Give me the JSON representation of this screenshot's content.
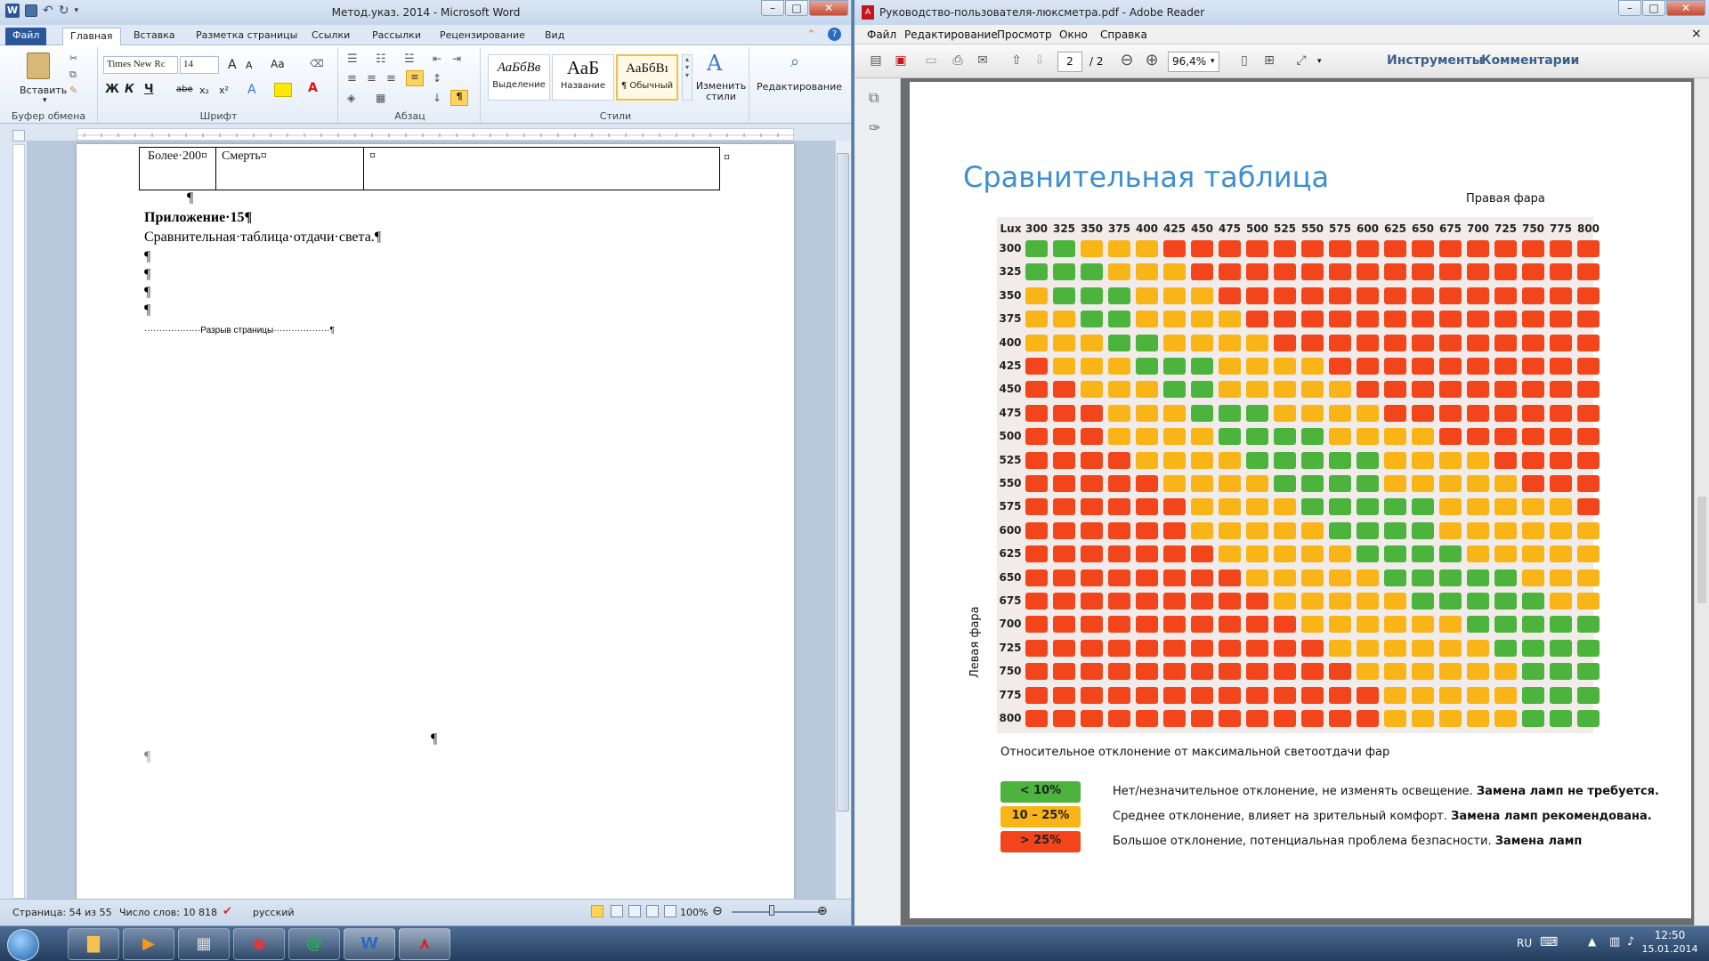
{
  "word": {
    "title": "Метод.указ. 2014  -  Microsoft Word",
    "tabs": [
      "Файл",
      "Главная",
      "Вставка",
      "Разметка страницы",
      "Ссылки",
      "Рассылки",
      "Рецензирование",
      "Вид"
    ],
    "clipboard": {
      "paste": "Вставить",
      "group": "Буфер обмена"
    },
    "font": {
      "name": "Times New Rc",
      "size": "14",
      "group": "Шрифт",
      "bold": "Ж",
      "italic": "К",
      "underline": "Ч",
      "strike": "abe",
      "sub": "x₂",
      "sup": "x²",
      "grow": "A",
      "shrink": "A",
      "case": "Aa",
      "color": "A"
    },
    "paragraph": {
      "group": "Абзац",
      "pilcrow": "¶"
    },
    "styles": {
      "group": "Стили",
      "items": [
        {
          "sample": "АаБбВв",
          "name": "Выделение"
        },
        {
          "sample": "АаБ",
          "name": "Название"
        },
        {
          "sample": "АаБбВı",
          "name": "¶ Обычный"
        }
      ],
      "change": "Изменить стили"
    },
    "editing": "Редактирование",
    "table": {
      "c1": "Более·200¤",
      "c2": "Смерть¤",
      "c3": "¤",
      "end": "¤"
    },
    "doc": {
      "pil": "¶",
      "heading": "Приложение·15¶",
      "line": "Сравнительная·таблица·отдачи·света.¶",
      "pagebreak": "···················Разрыв страницы···················¶"
    },
    "status": {
      "page": "Страница: 54 из 55",
      "words": "Число слов: 10 818",
      "lang": "русский",
      "zoom": "100%"
    }
  },
  "reader": {
    "title": "Руководство-пользователя-люксметра.pdf - Adobe Reader",
    "menu": [
      "Файл",
      "Редактирование",
      "Просмотр",
      "Окно",
      "Справка"
    ],
    "page_current": "2",
    "page_total": "/ 2",
    "zoom": "96,4%",
    "tools": "Инструменты",
    "comments": "Комментарии"
  },
  "pdf": {
    "title": "Сравнительная таблица",
    "right_label": "Правая фара",
    "left_label": "Левая фара",
    "corner": "Lux",
    "levels": [
      300,
      325,
      350,
      375,
      400,
      425,
      450,
      475,
      500,
      525,
      550,
      575,
      600,
      625,
      650,
      675,
      700,
      725,
      750,
      775,
      800
    ],
    "colors": {
      "g": "#4cb33d",
      "y": "#f9b418",
      "r": "#f2451c"
    },
    "grid": [
      "ggyyyrrrrrrrrrrrrrrrr",
      "gggyyyrrrrrrrrrrrrrrr",
      "ygggyyyrrrrrrrrrrrrrr",
      "yyggyyyyrrrrrrrrrrrrr",
      "yyyggyyyyrrrrrrrrrrrr",
      "ryyygggyyyyrrrrrrrrrr",
      "rryyyggyyyyyrrrrrrrrr",
      "rrryyygggyyyyrrrrrrrr",
      "rrryyyyggggyyyyrrrrrr",
      "rrrryyyygggggyyyyrrrr",
      "rrrrryyyyggggyyyyyrrr",
      "rrrrrryyyygggggyyyyyr",
      "rrrrrryyyyyggggyyyyyy",
      "rrrrrrryyyyyggggyyyyy",
      "rrrrrrrryyyyygggggyyy",
      "rrrrrrrrryyyyygggggyy",
      "rrrrrrrrrryyyyyyggggg",
      "rrrrrrrrrrryyyyyygggg",
      "rrrrrrrrrrrryyyyyyggg",
      "rrrrrrrrrrrrryyyyyggg",
      "rrrrrrrrrrrrryyyyyggg"
    ],
    "desc": "Относительное отклонение от максимальной светоотдачи фар",
    "legend": [
      {
        "label": "< 10%",
        "text": "Нет/незначительное  отклонение, не изменять освещение. ",
        "bold": "Замена ламп не требуется."
      },
      {
        "label": "10 – 25%",
        "text": "Среднее отклонение, влияет на зрительный комфорт. ",
        "bold": "Замена ламп рекомендована."
      },
      {
        "label": "> 25%",
        "text": "Большое  отклонение, потенциальная проблема безпасности. ",
        "bold": "Замена ламп"
      }
    ]
  },
  "taskbar": {
    "lang": "RU",
    "time": "12:50",
    "date": "15.01.2014"
  }
}
